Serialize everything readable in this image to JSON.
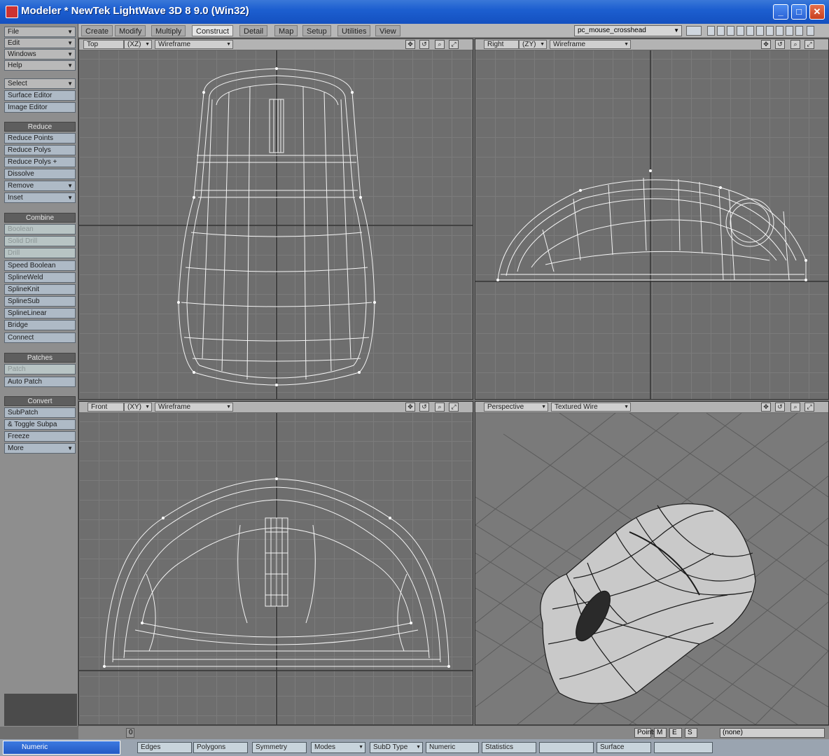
{
  "window": {
    "title": "Modeler * NewTek LightWave 3D 8 9.0 (Win32)",
    "min": "_",
    "max": "□",
    "close": "✕"
  },
  "left_toolbar": {
    "menus": [
      "File",
      "Edit",
      "Windows",
      "Help"
    ],
    "select": "Select",
    "editors": [
      "Surface Editor",
      "Image Editor"
    ],
    "reduce_header": "Reduce",
    "reduce_items": [
      "Reduce Points",
      "Reduce Polys",
      "Reduce Polys +",
      "Dissolve",
      "Remove",
      "Inset"
    ],
    "combine_header": "Combine",
    "combine_disabled": [
      "Boolean",
      "Solid Drill",
      "Drill"
    ],
    "combine_items": [
      "Speed Boolean",
      "SplineWeld",
      "SplineKnit",
      "SplineSub",
      "SplineLinear",
      "Bridge",
      "Connect"
    ],
    "patches_header": "Patches",
    "patches_disabled": [
      "Patch"
    ],
    "patches_items": [
      "Auto Patch"
    ],
    "convert_header": "Convert",
    "convert_items": [
      "SubPatch",
      "& Toggle Subpa",
      "Freeze",
      "More"
    ]
  },
  "tabs": {
    "items": [
      "Create",
      "Modify",
      "Multiply",
      "Construct",
      "Detail",
      "Map",
      "Setup",
      "Utilities",
      "View"
    ],
    "active": "Construct",
    "object_select": "pc_mouse_crosshead"
  },
  "viewports": {
    "top": {
      "view": "Top",
      "axis": "(XZ)",
      "mode": "Wireframe"
    },
    "right": {
      "view": "Right",
      "axis": "(ZY)",
      "mode": "Wireframe"
    },
    "front": {
      "view": "Front",
      "axis": "(XY)",
      "mode": "Wireframe"
    },
    "persp": {
      "view": "Perspective",
      "mode": "Textured Wire"
    }
  },
  "status": {
    "grid": "0",
    "modes": [
      "Points",
      "M",
      "E",
      "S"
    ],
    "surface": "(none)"
  },
  "bottom_bar": {
    "task": "Numeric",
    "edges": "Edges",
    "polygons": "Polygons",
    "symmetry": "Symmetry",
    "modes": "Modes",
    "subd_type": "SubD Type",
    "numeric": "Numeric",
    "statistics": "Statistics",
    "info": "",
    "surface": "Surface",
    "vmap": ""
  },
  "colors": {
    "titlebar": "#1d5fd0",
    "viewport_bg": "#6e6e6e",
    "wire": "#ffffff"
  }
}
